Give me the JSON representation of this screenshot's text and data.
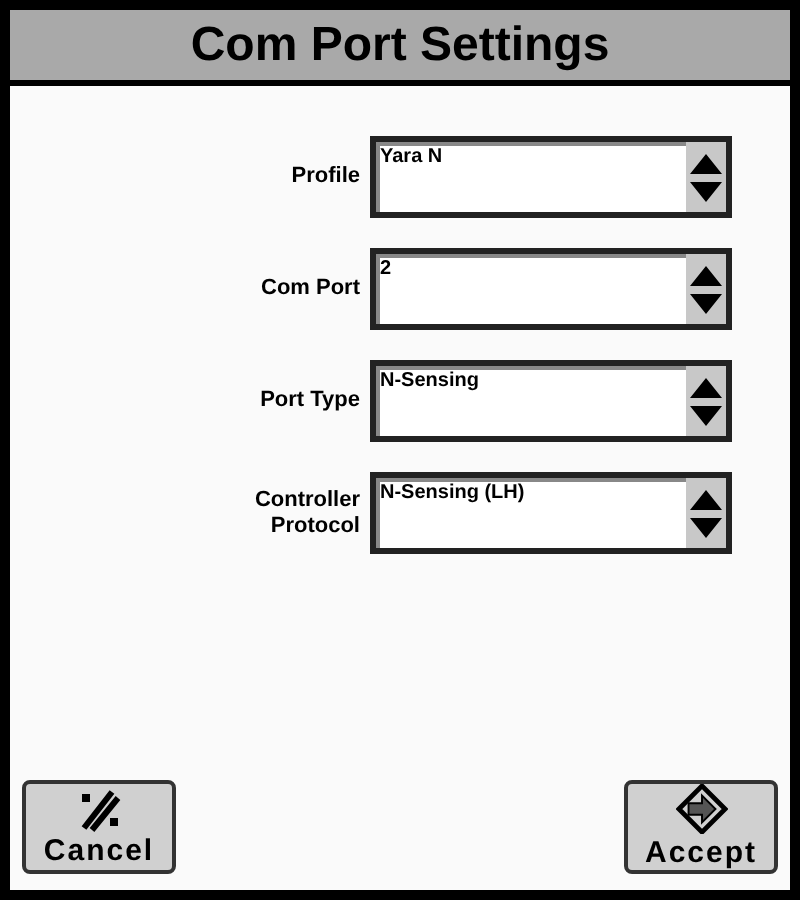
{
  "title": "Com Port Settings",
  "fields": [
    {
      "label": "Profile",
      "value": "Yara N"
    },
    {
      "label": "Com Port",
      "value": "2"
    },
    {
      "label": "Port Type",
      "value": "N-Sensing"
    },
    {
      "label": "Controller Protocol",
      "value": "N-Sensing (LH)"
    }
  ],
  "buttons": [
    {
      "kind": "cancel",
      "label": "Cancel"
    },
    {
      "kind": "accept",
      "label": "Accept"
    }
  ]
}
